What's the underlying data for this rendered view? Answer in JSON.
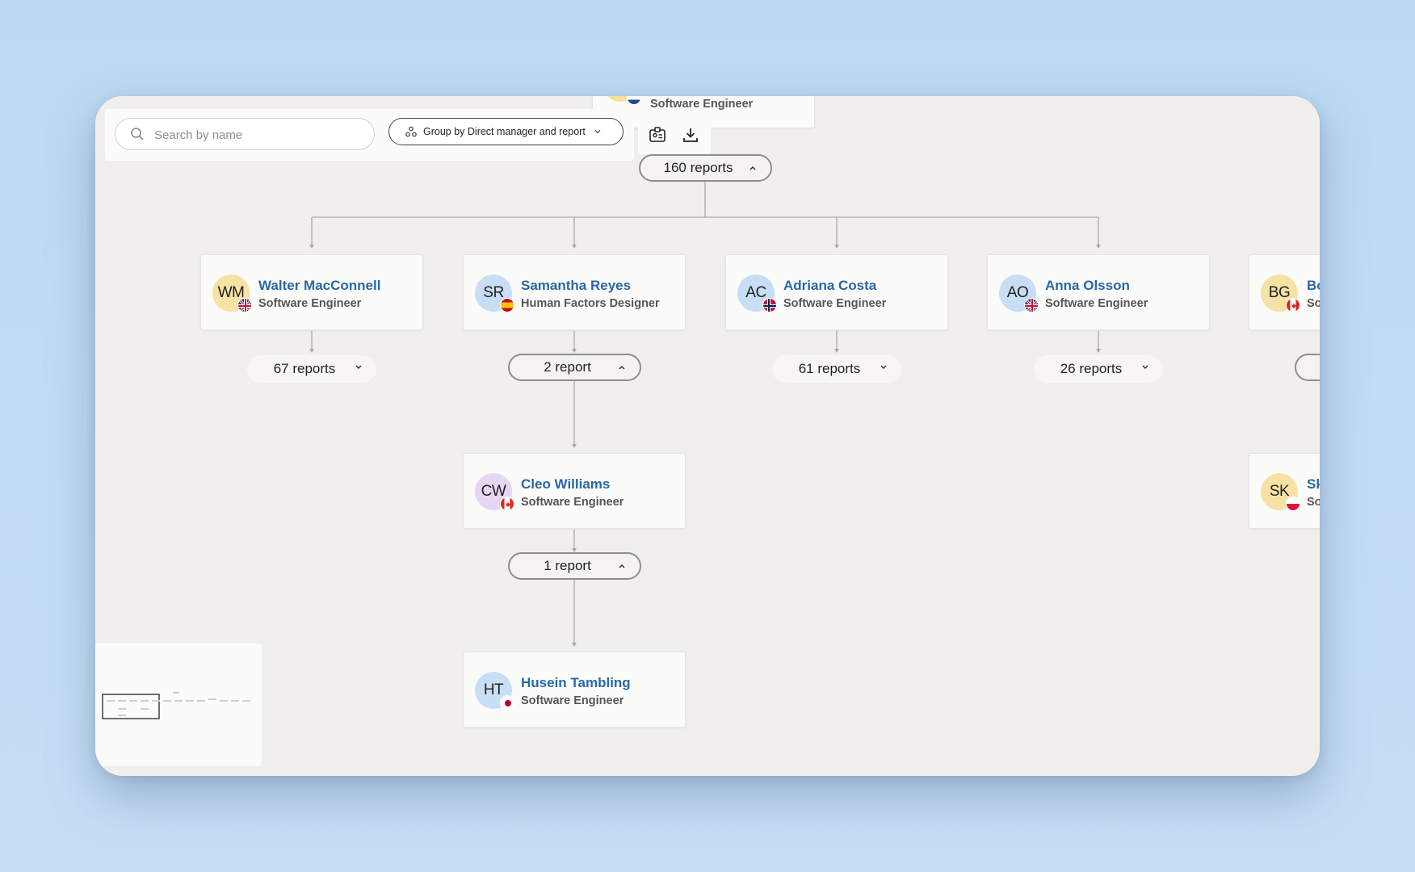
{
  "toolbar": {
    "search_placeholder": "Search by name",
    "group_by_label": "Group by Direct manager and report"
  },
  "icons": {
    "search": "search-icon",
    "group": "group-icon",
    "chevron": "chevron-down-icon",
    "id_card": "id-card-icon",
    "download": "download-icon"
  },
  "colors": {
    "name_link": "#2a67a4",
    "canvas": "#f1efec",
    "background": "#bcd9f3"
  },
  "top_card": {
    "role": "Software Engineer"
  },
  "root_reports": "160 reports",
  "direct_reports": [
    {
      "initials": "WM",
      "name": "Walter MacConnell",
      "role": "Software Engineer",
      "reports": "67 reports",
      "expanded": false,
      "flag": "uk"
    },
    {
      "initials": "SR",
      "name": "Samantha Reyes",
      "role": "Human Factors Designer",
      "reports": "2 report",
      "expanded": true,
      "flag": "spain"
    },
    {
      "initials": "AC",
      "name": "Adriana Costa",
      "role": "Software Engineer",
      "reports": "61 reports",
      "expanded": false,
      "flag": "norway"
    },
    {
      "initials": "AO",
      "name": "Anna Olsson",
      "role": "Software Engineer",
      "reports": "26 reports",
      "expanded": false,
      "flag": "uk"
    },
    {
      "initials": "BG",
      "name": "Bo",
      "role": "So",
      "flag": "canada"
    }
  ],
  "sub_reports": [
    {
      "initials": "CW",
      "name": "Cleo Williams",
      "role": "Software Engineer",
      "reports": "1 report",
      "expanded": true,
      "flag": "canada"
    },
    {
      "initials": "HT",
      "name": "Husein Tambling",
      "role": "Software Engineer",
      "flag": "japan"
    }
  ],
  "partial_right": {
    "initials": "SK",
    "name": "Sk",
    "role": "So",
    "flag": "poland"
  }
}
